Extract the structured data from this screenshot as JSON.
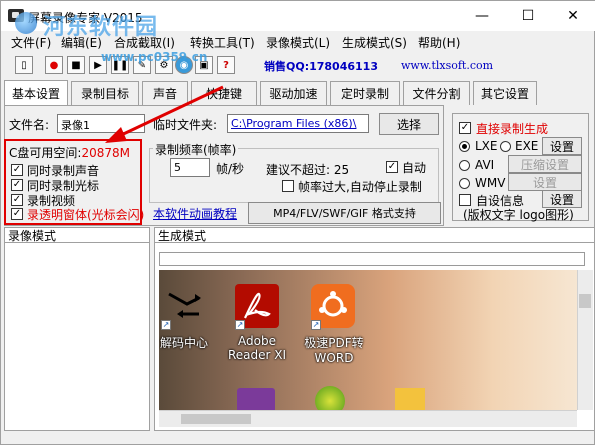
{
  "window": {
    "title": "屏幕录像专家 V2015",
    "watermark_text": "河东软件园",
    "watermark_url": "www.pc0359.cn",
    "controls": {
      "minimize": "—",
      "maximize": "☐",
      "close": "✕"
    }
  },
  "menu": {
    "items": [
      "文件(F)",
      "编辑(E)",
      "合成截取(I)",
      "转换工具(T)",
      "录像模式(L)",
      "生成模式(S)",
      "帮助(H)"
    ]
  },
  "toolbar": {
    "qq": "销售QQ:178046113",
    "website": "www.tlxsoft.com"
  },
  "tabs": [
    "基本设置",
    "录制目标",
    "声音",
    "快捷键",
    "驱动加速",
    "定时录制",
    "文件分割",
    "其它设置"
  ],
  "basic": {
    "filename_label": "文件名:",
    "filename_value": "录像1",
    "temp_folder_label": "临时文件夹:",
    "temp_folder_value": "C:\\Program Files (x86)\\",
    "browse_button": "选择",
    "free_space_label": "C盘可用空间:",
    "free_space_value": "20878M",
    "checkboxes": [
      {
        "label": "同时录制声音",
        "checked": true
      },
      {
        "label": "同时录制光标",
        "checked": true
      },
      {
        "label": "录制视频",
        "checked": true
      },
      {
        "label": "录透明窗体(光标会闪)",
        "checked": true
      }
    ],
    "framerate_group": "录制频率(帧率)",
    "framerate_value": "5",
    "framerate_unit": "帧/秒",
    "suggest_text": "建议不超过: 25",
    "auto_label": "自动",
    "auto_checked": true,
    "auto_stop_label": "帧率过大,自动停止录制",
    "auto_stop_checked": false,
    "tutorial_link": "本软件动画教程",
    "format_button": "MP4/FLV/SWF/GIF  格式支持"
  },
  "right_panel": {
    "direct_label": "直接录制生成",
    "direct_checked": true,
    "radios": [
      {
        "label": "LXE",
        "checked": true
      },
      {
        "label": "EXE",
        "checked": false
      },
      {
        "label": "AVI",
        "checked": false
      },
      {
        "label": "WMV",
        "checked": false
      }
    ],
    "settings_button": "设置",
    "compress_button": "压缩设置",
    "wmv_settings_button": "设置",
    "custom_info_label": "自设信息",
    "custom_info_checked": false,
    "custom_settings_button": "设置",
    "copyright_text": "(版权文字 logo图形)"
  },
  "bottom": {
    "left_tab": "录像模式",
    "right_tab": "生成模式",
    "desktop_icons": [
      {
        "label": "解码中心"
      },
      {
        "label": "Adobe\nReader XI"
      },
      {
        "label": "极速PDF转\nWORD"
      }
    ]
  },
  "colors": {
    "accent_red": "#e00000",
    "link_blue": "#0000c0"
  }
}
